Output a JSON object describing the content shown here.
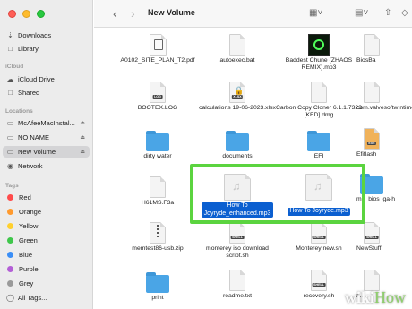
{
  "window": {
    "title": "New Volume"
  },
  "sidebar": {
    "favorites": [
      {
        "label": "Downloads",
        "icon": "download-icon"
      },
      {
        "label": "Library",
        "icon": "folder-icon"
      }
    ],
    "icloud_header": "iCloud",
    "icloud": [
      {
        "label": "iCloud Drive",
        "icon": "cloud-icon"
      },
      {
        "label": "Shared",
        "icon": "shared-folder-icon"
      }
    ],
    "locations_header": "Locations",
    "locations": [
      {
        "label": "McAfeeMacInstal...",
        "icon": "disk-icon"
      },
      {
        "label": "NO NAME",
        "icon": "disk-icon"
      },
      {
        "label": "New Volume",
        "icon": "disk-icon"
      },
      {
        "label": "Network",
        "icon": "globe-icon"
      }
    ],
    "tags_header": "Tags",
    "tags": [
      {
        "label": "Red",
        "color": "#ff4b4b"
      },
      {
        "label": "Orange",
        "color": "#ff9a2e"
      },
      {
        "label": "Yellow",
        "color": "#ffd02e"
      },
      {
        "label": "Green",
        "color": "#3fc74b"
      },
      {
        "label": "Blue",
        "color": "#3a8ef6"
      },
      {
        "label": "Purple",
        "color": "#b35fd6"
      },
      {
        "label": "Grey",
        "color": "#9a9a9a"
      }
    ],
    "all_tags": "All Tags..."
  },
  "files": {
    "row1": [
      "A0102_SITE_PLAN_T2.pdf",
      "autoexec.bat",
      "Baddest Chune (ZHAOS REMIX).mp3",
      "BiosBa"
    ],
    "row2": [
      "BOOTEX.LOG",
      "calculations 19-06-2023.xlsx",
      "Carbon Copy Cloner 6.1.1.7323 [KED].dmg",
      "com.valvesoftw ntime.Sdk-a...t"
    ],
    "row3": [
      "dirty water",
      "documents",
      "EFI",
      "Efiflash"
    ],
    "row4": [
      "H61MS.F3a",
      "How To Joyryde_enhanced.mp3",
      "How To Joyryde.mp3",
      "mb_bios_ga-h"
    ],
    "row5": [
      "memtest86-usb.zip",
      "monterey iso download script.sh",
      "Monterey new.sh",
      "NewStuff"
    ],
    "row6": [
      "print",
      "readme.txt",
      "recovery.sh",
      "r..."
    ]
  },
  "doc_tags": {
    "log": "LOG",
    "xlsx": "XLSX",
    "shell": "SHELL",
    "exe": "EXE"
  },
  "watermark": {
    "wiki": "wiki",
    "how": "How"
  }
}
